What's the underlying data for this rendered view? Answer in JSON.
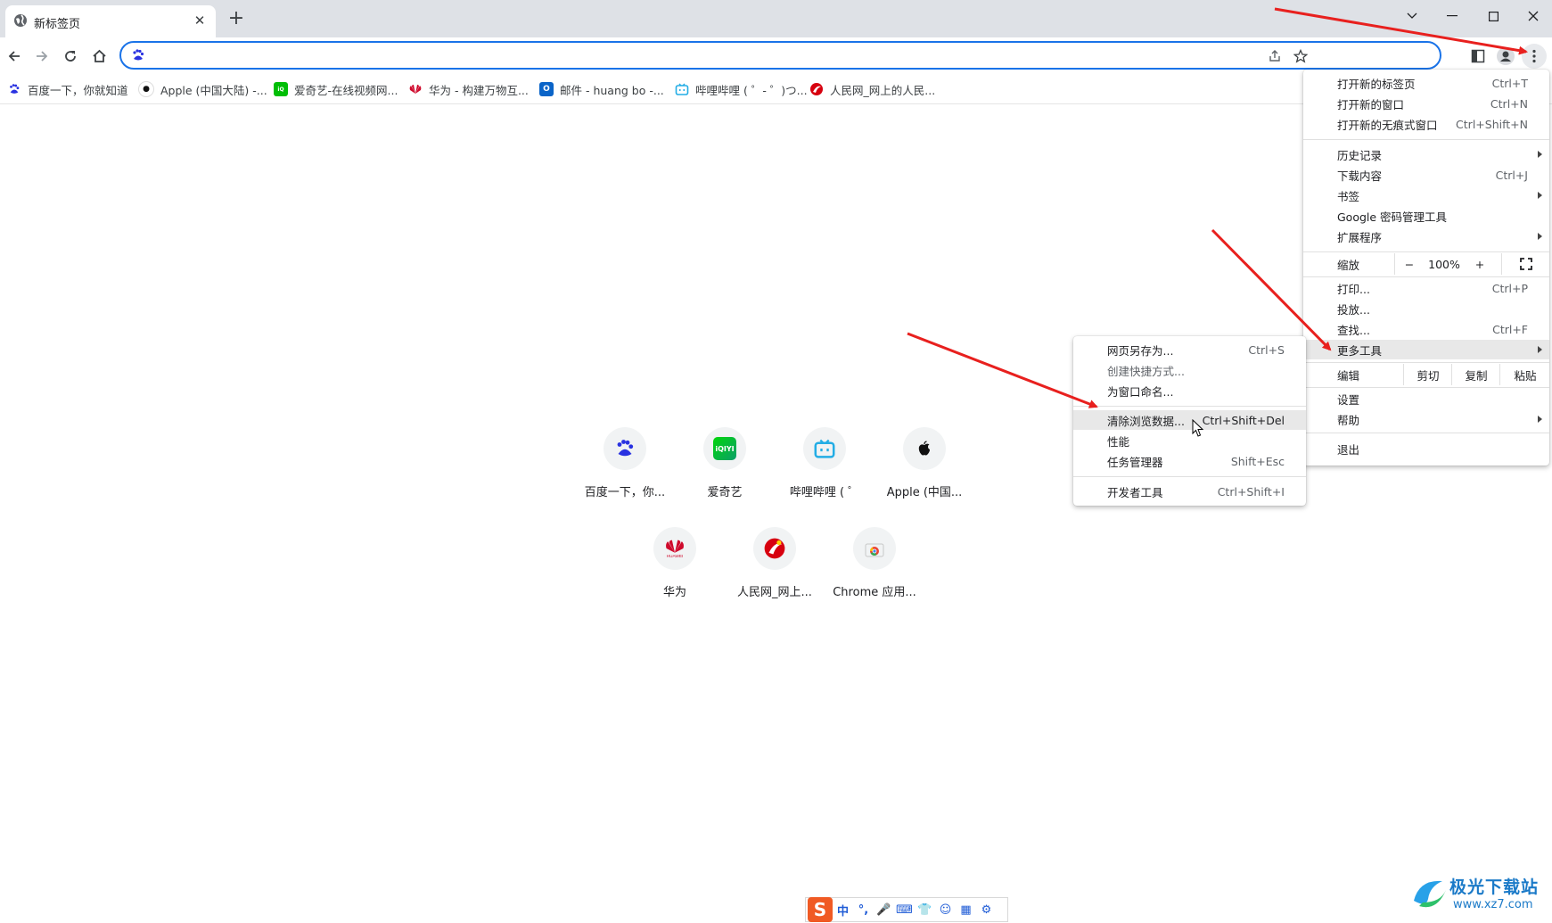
{
  "tab": {
    "title": "新标签页"
  },
  "omnibox": {
    "value": "",
    "placeholder": ""
  },
  "bookmarks": [
    {
      "label": "百度一下，你就知道",
      "icon": "baidu-icon"
    },
    {
      "label": "Apple (中国大陆) -...",
      "icon": "apple-icon"
    },
    {
      "label": "爱奇艺-在线视频网...",
      "icon": "iqiyi-icon"
    },
    {
      "label": "华为 - 构建万物互...",
      "icon": "huawei-icon"
    },
    {
      "label": "邮件 - huang bo -...",
      "icon": "outlook-icon"
    },
    {
      "label": "哔哩哔哩 ( ゜- ゜)つ...",
      "icon": "bilibili-icon"
    },
    {
      "label": "人民网_网上的人民...",
      "icon": "people-daily-icon"
    }
  ],
  "shortcuts": [
    {
      "label": "百度一下，你...",
      "icon": "baidu-icon"
    },
    {
      "label": "爱奇艺",
      "icon": "iqiyi-icon"
    },
    {
      "label": "哔哩哔哩 ( ゜",
      "icon": "bilibili-icon"
    },
    {
      "label": "Apple (中国...",
      "icon": "apple-icon"
    },
    {
      "label": "华为",
      "icon": "huawei-icon"
    },
    {
      "label": "人民网_网上...",
      "icon": "people-daily-icon"
    },
    {
      "label": "Chrome 应用...",
      "icon": "chrome-web-store-icon"
    }
  ],
  "main_menu": {
    "new_tab": {
      "label": "打开新的标签页",
      "shortcut": "Ctrl+T"
    },
    "new_window": {
      "label": "打开新的窗口",
      "shortcut": "Ctrl+N"
    },
    "new_incognito": {
      "label": "打开新的无痕式窗口",
      "shortcut": "Ctrl+Shift+N"
    },
    "history": {
      "label": "历史记录"
    },
    "downloads": {
      "label": "下载内容",
      "shortcut": "Ctrl+J"
    },
    "bookmarks": {
      "label": "书签"
    },
    "passwords": {
      "label": "Google 密码管理工具"
    },
    "extensions": {
      "label": "扩展程序"
    },
    "zoom": {
      "label": "缩放",
      "minus": "−",
      "value": "100%",
      "plus": "+"
    },
    "print": {
      "label": "打印...",
      "shortcut": "Ctrl+P"
    },
    "cast": {
      "label": "投放..."
    },
    "find": {
      "label": "查找...",
      "shortcut": "Ctrl+F"
    },
    "more_tools": {
      "label": "更多工具"
    },
    "edit": {
      "label": "编辑",
      "cut": "剪切",
      "copy": "复制",
      "paste": "粘贴"
    },
    "settings": {
      "label": "设置"
    },
    "help": {
      "label": "帮助"
    },
    "exit": {
      "label": "退出"
    }
  },
  "submenu": {
    "save_page": {
      "label": "网页另存为...",
      "shortcut": "Ctrl+S"
    },
    "create_shortcut": {
      "label": "创建快捷方式..."
    },
    "name_window": {
      "label": "为窗口命名..."
    },
    "clear_data": {
      "label": "清除浏览数据...",
      "shortcut": "Ctrl+Shift+Del"
    },
    "performance": {
      "label": "性能"
    },
    "task_manager": {
      "label": "任务管理器",
      "shortcut": "Shift+Esc"
    },
    "devtools": {
      "label": "开发者工具",
      "shortcut": "Ctrl+Shift+I"
    }
  },
  "ime": {
    "items": [
      "中",
      "°,",
      "🎤",
      "⌨",
      "👕",
      "☺",
      "▦",
      "⚙"
    ]
  },
  "watermark": {
    "line1": "极光下载站",
    "line2": "www.xz7.com"
  },
  "colors": {
    "accent": "#1a73e8",
    "arrow": "#e8201e",
    "tabstrip": "#dee1e6",
    "highlight": "#e8e8e8"
  }
}
